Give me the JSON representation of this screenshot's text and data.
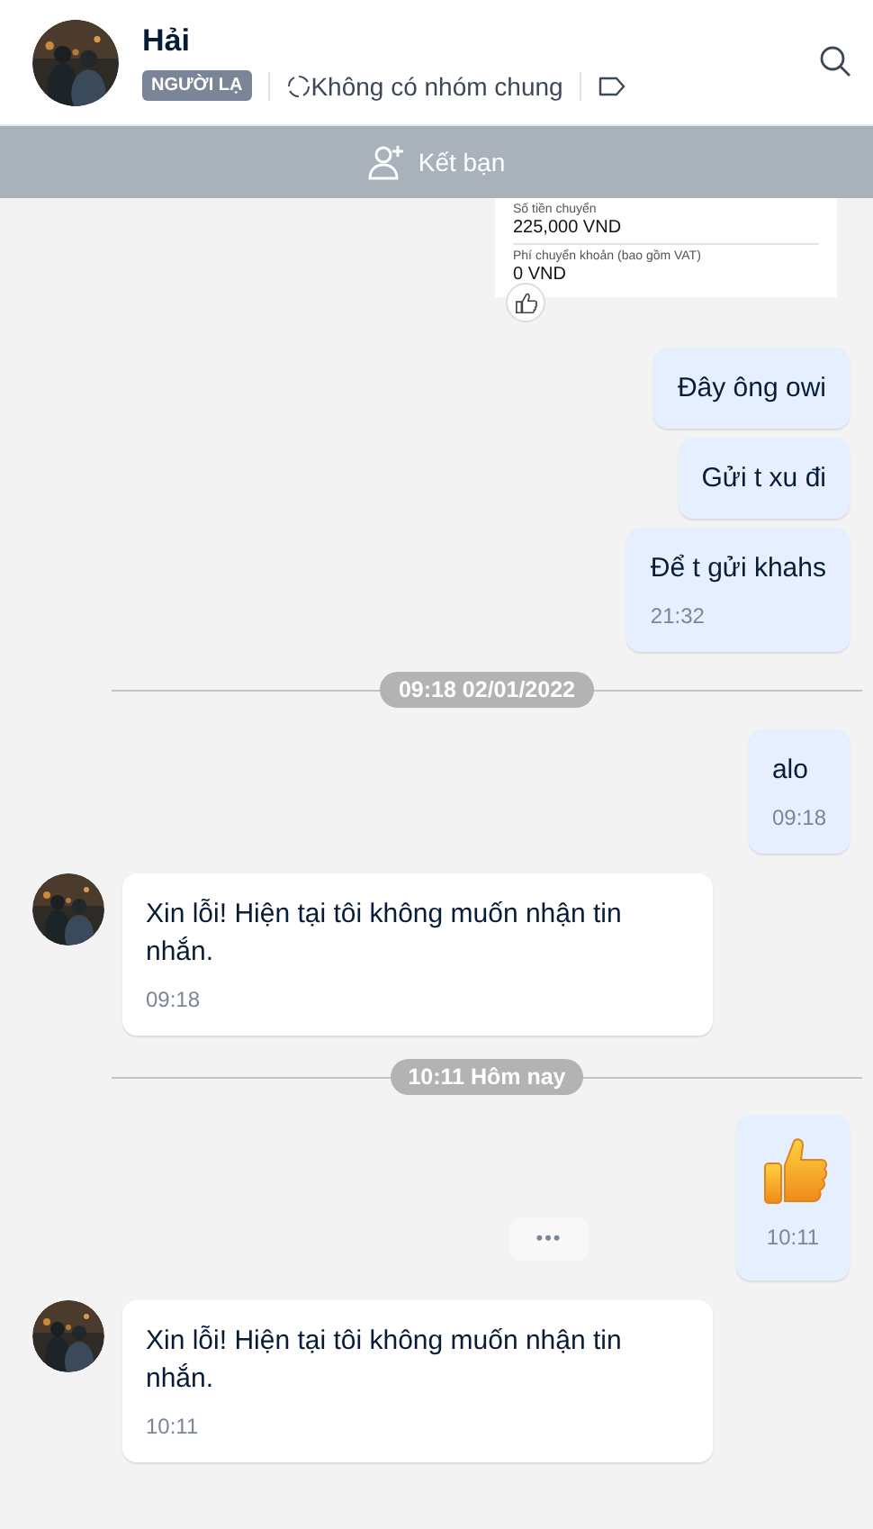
{
  "header": {
    "name": "Hải",
    "badge": "NGƯỜI LẠ",
    "groups": "Không có nhóm chung"
  },
  "add_friend_button": {
    "label": "Kết bạn"
  },
  "messages": [
    {
      "kind": "receipt",
      "lines": [
        {
          "label": "Số tiền chuyển",
          "value": "225,000 VND"
        },
        {
          "label": "Phí chuyển khoản (bao gồm VAT)",
          "value": "0 VND"
        }
      ],
      "liked": true
    },
    {
      "kind": "sent",
      "text": "Đây ông owi"
    },
    {
      "kind": "sent",
      "text": "Gửi t xu đi"
    },
    {
      "kind": "sent",
      "text": "Để t gửi khahs",
      "time": "21:32"
    },
    {
      "kind": "divider",
      "text": "09:18 02/01/2022"
    },
    {
      "kind": "sent",
      "text": "alo",
      "time": "09:18"
    },
    {
      "kind": "received",
      "text": "Xin lỗi! Hiện tại tôi không muốn nhận tin nhắn.",
      "time": "09:18"
    },
    {
      "kind": "divider",
      "text": "10:11 Hôm nay"
    },
    {
      "kind": "sticker",
      "time": "10:11",
      "more": "•••"
    },
    {
      "kind": "received",
      "text": "Xin lỗi! Hiện tại tôi không muốn nhận tin nhắn.",
      "time": "10:11"
    }
  ]
}
